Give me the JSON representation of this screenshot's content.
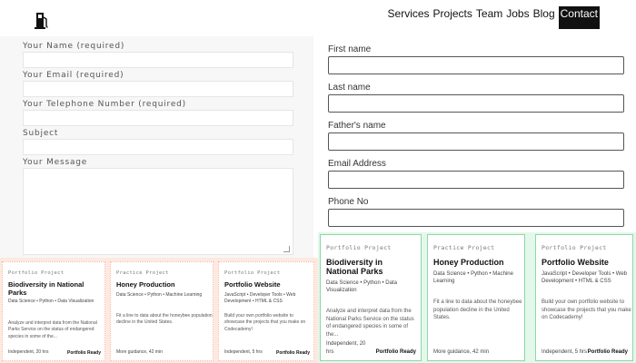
{
  "nav": {
    "items": [
      "Services",
      "Projects",
      "Team",
      "Jobs",
      "Blog"
    ],
    "active": "Contact"
  },
  "form_left": {
    "name_label": "Your Name (required)",
    "email_label": "Your Email (required)",
    "phone_label": "Your Telephone Number (required)",
    "subject_label": "Subject",
    "message_label": "Your Message"
  },
  "form_right": {
    "first_name_label": "First name",
    "last_name_label": "Last name",
    "father_name_label": "Father's name",
    "email_label": "Email Address",
    "phone_label": "Phone No"
  },
  "cards": [
    {
      "type": "Portfolio Project",
      "title": "Biodiversity in National Parks",
      "tags": "Data Science • Python • Data Visualization",
      "desc": "Analyze and interpret data from the National Parks Service on the status of endangered species in some of the...",
      "meta": "Independent, 20 hrs",
      "ready": "Portfolio Ready"
    },
    {
      "type": "Practice Project",
      "title": "Honey Production",
      "tags": "Data Science • Python • Machine Learning",
      "desc": "Fit a line to data about the honeybee population decline in the United States.",
      "meta": "More guidance, 42 min",
      "ready": ""
    },
    {
      "type": "Portfolio Project",
      "title": "Portfolio Website",
      "tags": "JavaScript • Developer Tools • Web Development • HTML & CSS",
      "desc": "Build your own portfolio website to showcase the projects that you make on Codecademy!",
      "meta": "Independent, 5 hrs",
      "ready": "Portfolio Ready"
    }
  ],
  "colors": {
    "small_bg": "#fde9df",
    "big_bg": "#e3f8ea",
    "big_border": "#8fd6a7"
  },
  "icons": {
    "logo": "fuel-pump-icon"
  }
}
